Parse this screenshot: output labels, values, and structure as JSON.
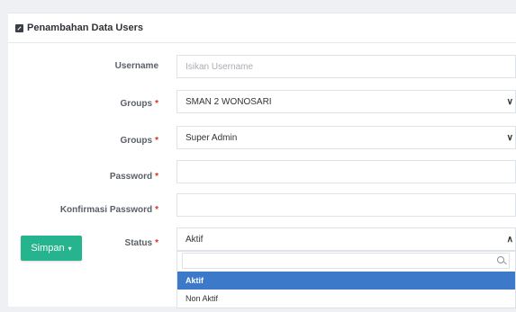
{
  "panel": {
    "title": "Penambahan Data Users"
  },
  "form": {
    "username": {
      "label": "Username",
      "placeholder": "Isikan Username"
    },
    "groups1": {
      "label": "Groups",
      "value": "SMAN 2 WONOSARI"
    },
    "groups2": {
      "label": "Groups",
      "value": "Super Admin"
    },
    "password": {
      "label": "Password"
    },
    "konfirmasi": {
      "label": "Konfirmasi Password"
    },
    "status": {
      "label": "Status",
      "value": "Aktif"
    },
    "required_mark": "*"
  },
  "status_dropdown": {
    "search_value": "",
    "options": [
      "Aktif",
      "Non Aktif"
    ],
    "highlighted": "Aktif"
  },
  "actions": {
    "save_label": "Simpan",
    "save_caret": "▾"
  },
  "icons": {
    "chevron_down": "∨",
    "chevron_up": "∧"
  },
  "colors": {
    "save_button": "#25b48d",
    "highlight_option": "#3c79c9",
    "required": "#d9312b"
  }
}
